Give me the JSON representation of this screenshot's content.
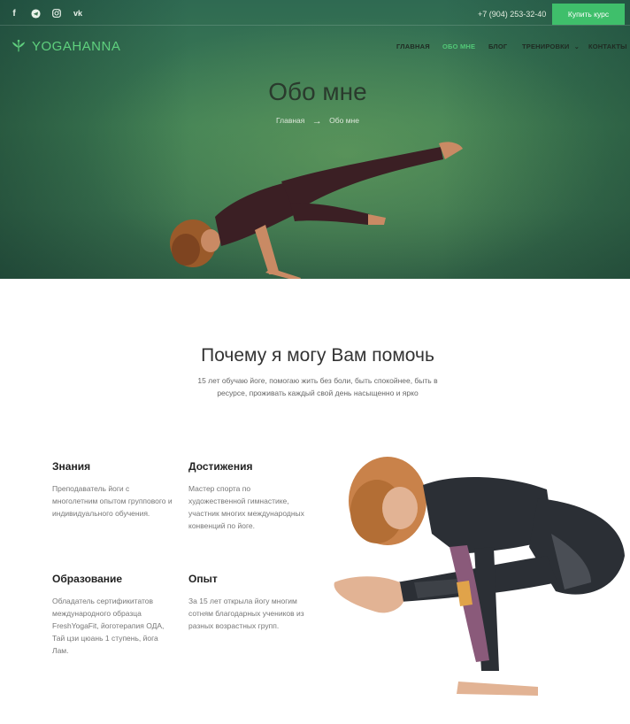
{
  "topbar": {
    "socials": [
      {
        "icon": "facebook-icon",
        "glyph": "f"
      },
      {
        "icon": "telegram-icon",
        "glyph": "➤"
      },
      {
        "icon": "instagram-icon",
        "glyph": "◎"
      },
      {
        "icon": "vk-icon",
        "glyph": "vk"
      }
    ],
    "phone": "+7 (904) 253-32-40",
    "buy_label": "Купить курс"
  },
  "logo": {
    "text": "YOGAHANNA",
    "icon": "lotus-icon"
  },
  "nav": {
    "items": [
      {
        "label": "ГЛАВНАЯ",
        "active": false
      },
      {
        "label": "ОБО МНЕ",
        "active": true
      },
      {
        "label": "БЛОГ",
        "active": false
      },
      {
        "label": "ТРЕНИРОВКИ",
        "active": false,
        "dropdown": true
      },
      {
        "label": "КОНТАКТЫ",
        "active": false
      }
    ]
  },
  "hero": {
    "title": "Обо мне",
    "breadcrumb": {
      "home": "Главная",
      "current": "Обо мне"
    }
  },
  "section": {
    "title": "Почему я могу Вам помочь",
    "subtitle": "15 лет обучаю йоге, помогаю жить без боли, быть спокойнее, быть в ресурсе, проживать каждый свой день насыщенно и ярко"
  },
  "features": [
    {
      "title": "Знания",
      "text": "Преподаватель йоги с многолетним опытом группового и индивидуального обучения."
    },
    {
      "title": "Достижения",
      "text": "Мастер спорта по художественной гимнастике, участник многих международных конвенций по йоге."
    },
    {
      "title": "Образование",
      "text": "Обладатель сертификитатов международного образца FreshYogaFit, йоготерапия ОДА, Тай цзи цюань 1 ступень, йога Лам."
    },
    {
      "title": "Опыт",
      "text": "За 15 лет открыла йогу многим сотням благодарных учеников из разных возрастных групп."
    }
  ],
  "colors": {
    "accent": "#3fbf6b",
    "hero_green": "#3f7f55",
    "logo_green": "#5fd17e"
  }
}
